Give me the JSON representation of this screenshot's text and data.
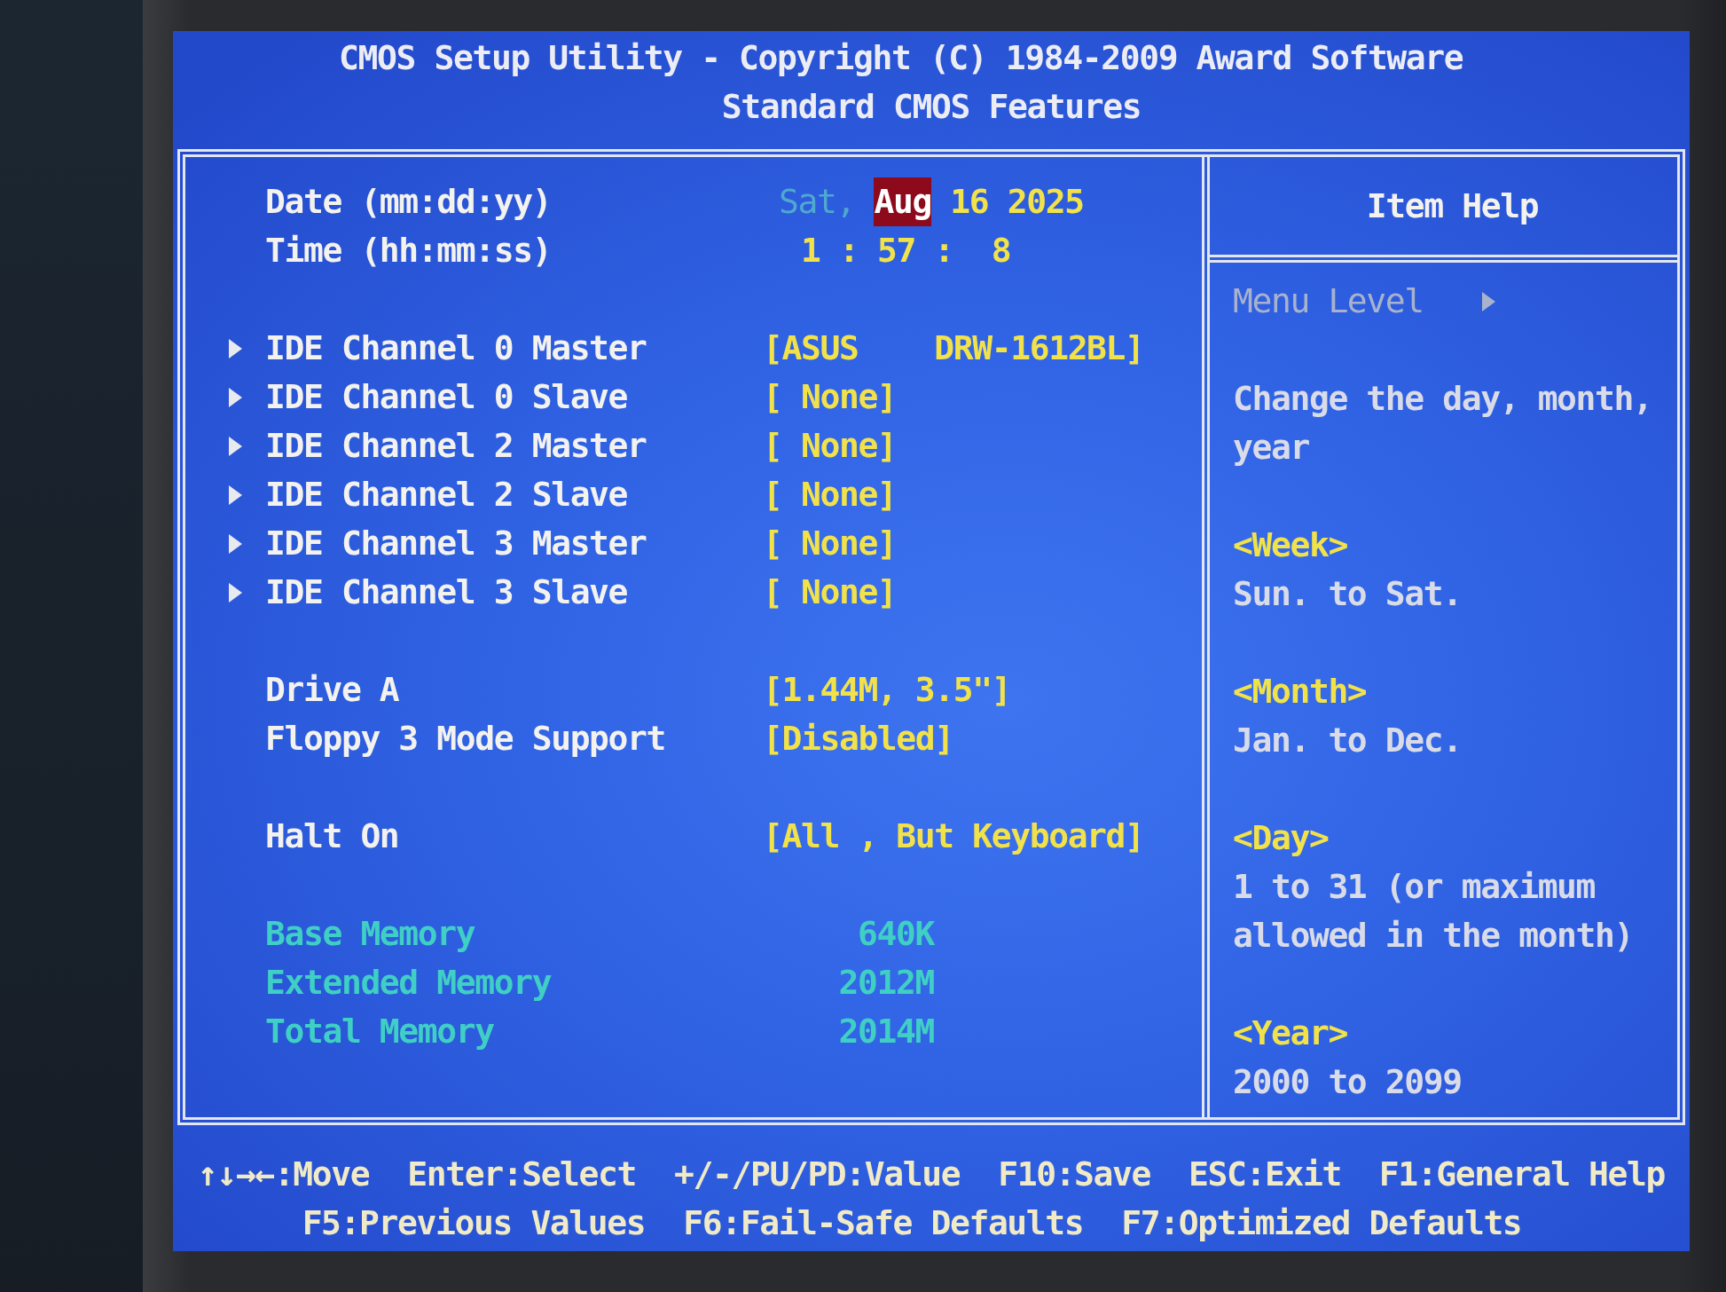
{
  "header": {
    "title": "CMOS Setup Utility - Copyright (C) 1984-2009 Award Software",
    "subtitle": "Standard CMOS Features"
  },
  "setting_groups": [
    {
      "rows": [
        {
          "kind": "date",
          "label": "Date (mm:dd:yy)",
          "weekday": "Sat,",
          "fields": [
            {
              "text": "Aug",
              "selected": true
            },
            {
              "text": "16",
              "selected": false
            },
            {
              "text": "2025",
              "selected": false
            }
          ]
        },
        {
          "kind": "time",
          "label": "Time (hh:mm:ss)",
          "value": "1 : 57 :  8"
        }
      ]
    },
    {
      "rows": [
        {
          "kind": "submenu",
          "label": "IDE Channel 0 Master",
          "value": "[ASUS    DRW-1612BL]"
        },
        {
          "kind": "submenu",
          "label": "IDE Channel 0 Slave",
          "value": "[ None]"
        },
        {
          "kind": "submenu",
          "label": "IDE Channel 2 Master",
          "value": "[ None]"
        },
        {
          "kind": "submenu",
          "label": "IDE Channel 2 Slave",
          "value": "[ None]"
        },
        {
          "kind": "submenu",
          "label": "IDE Channel 3 Master",
          "value": "[ None]"
        },
        {
          "kind": "submenu",
          "label": "IDE Channel 3 Slave",
          "value": "[ None]"
        }
      ]
    },
    {
      "rows": [
        {
          "kind": "option",
          "label": "Drive A",
          "value": "[1.44M, 3.5\"]"
        },
        {
          "kind": "option",
          "label": "Floppy 3 Mode Support",
          "value": "[Disabled]"
        }
      ]
    },
    {
      "rows": [
        {
          "kind": "option",
          "label": "Halt On",
          "value": "[All , But Keyboard]"
        }
      ]
    },
    {
      "rows": [
        {
          "kind": "info",
          "label": "Base Memory",
          "value": "640K"
        },
        {
          "kind": "info",
          "label": "Extended Memory",
          "value": "2012M"
        },
        {
          "kind": "info",
          "label": "Total Memory",
          "value": "2014M"
        }
      ]
    }
  ],
  "item_help": {
    "title": "Item Help",
    "menu_level": "Menu Level",
    "description": "Change the day, month, year",
    "sections": [
      {
        "heading": "<Week>",
        "text": "Sun. to Sat."
      },
      {
        "heading": "<Month>",
        "text": "Jan. to Dec."
      },
      {
        "heading": "<Day>",
        "text": "1 to 31 (or maximum allowed in the month)"
      },
      {
        "heading": "<Year>",
        "text": "2000 to 2099"
      }
    ]
  },
  "footer": {
    "lines": [
      {
        "hints": [
          "↑↓→←:Move",
          "Enter:Select",
          "+/-/PU/PD:Value",
          "F10:Save",
          "ESC:Exit",
          "F1:General Help"
        ]
      },
      {
        "hints": [
          "F5:Previous Values",
          "F6:Fail-Safe Defaults",
          "F7:Optimized Defaults"
        ]
      }
    ]
  }
}
